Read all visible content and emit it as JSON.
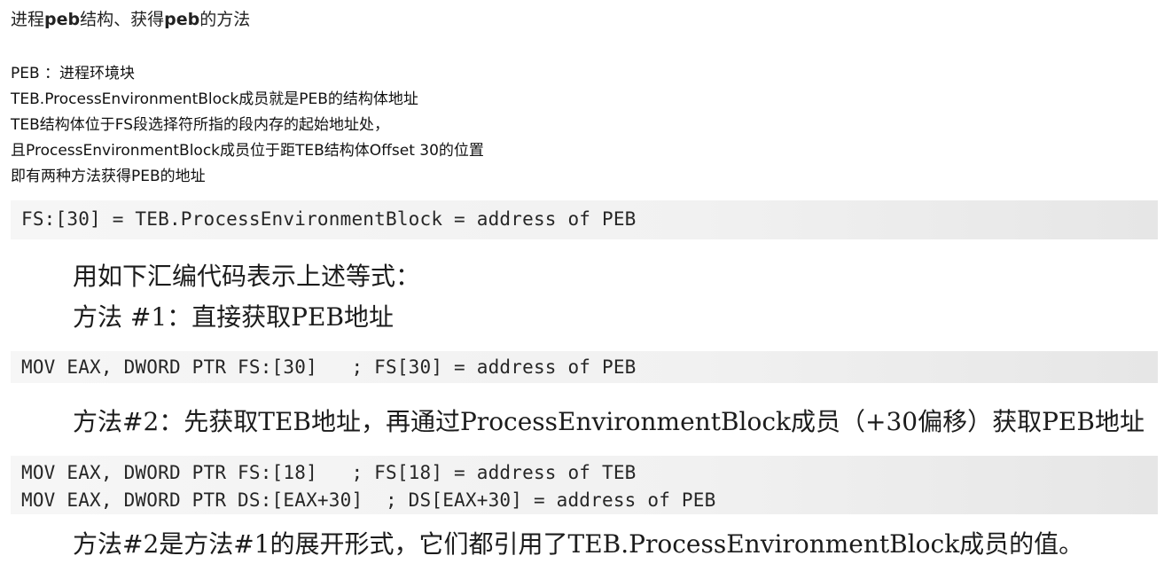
{
  "heading": {
    "part1": "进程",
    "part2": "peb",
    "part3": "结构、获得",
    "part4": "peb",
    "part5": "的方法"
  },
  "intro_lines": [
    "PEB ：进程环境块",
    "TEB.ProcessEnvironmentBlock成员就是PEB的结构体地址",
    "TEB结构体位于FS段选择符所指的段内存的起始地址处，",
    "且ProcessEnvironmentBlock成员位于距TEB结构体Offset 30的位置",
    "即有两种方法获得PEB的地址"
  ],
  "scan": {
    "equation": "FS:[30] = TEB.ProcessEnvironmentBlock = address of PEB",
    "intro_text": "用如下汇编代码表示上述等式：",
    "method1_title": "方法 #1：直接获取PEB地址",
    "method1_code": "MOV EAX, DWORD PTR FS:[30]   ; FS[30] = address of PEB",
    "method2_title": "方法#2：先获取TEB地址，再通过ProcessEnvironmentBlock成员（+30偏移）获取PEB地址",
    "method2_code_1": "MOV EAX, DWORD PTR FS:[18]   ; FS[18] = address of TEB",
    "method2_code_2": "MOV EAX, DWORD PTR DS:[EAX+30]  ; DS[EAX+30] = address of PEB",
    "conclusion": "方法#2是方法#1的展开形式，它们都引用了TEB.ProcessEnvironmentBlock成员的值。"
  }
}
